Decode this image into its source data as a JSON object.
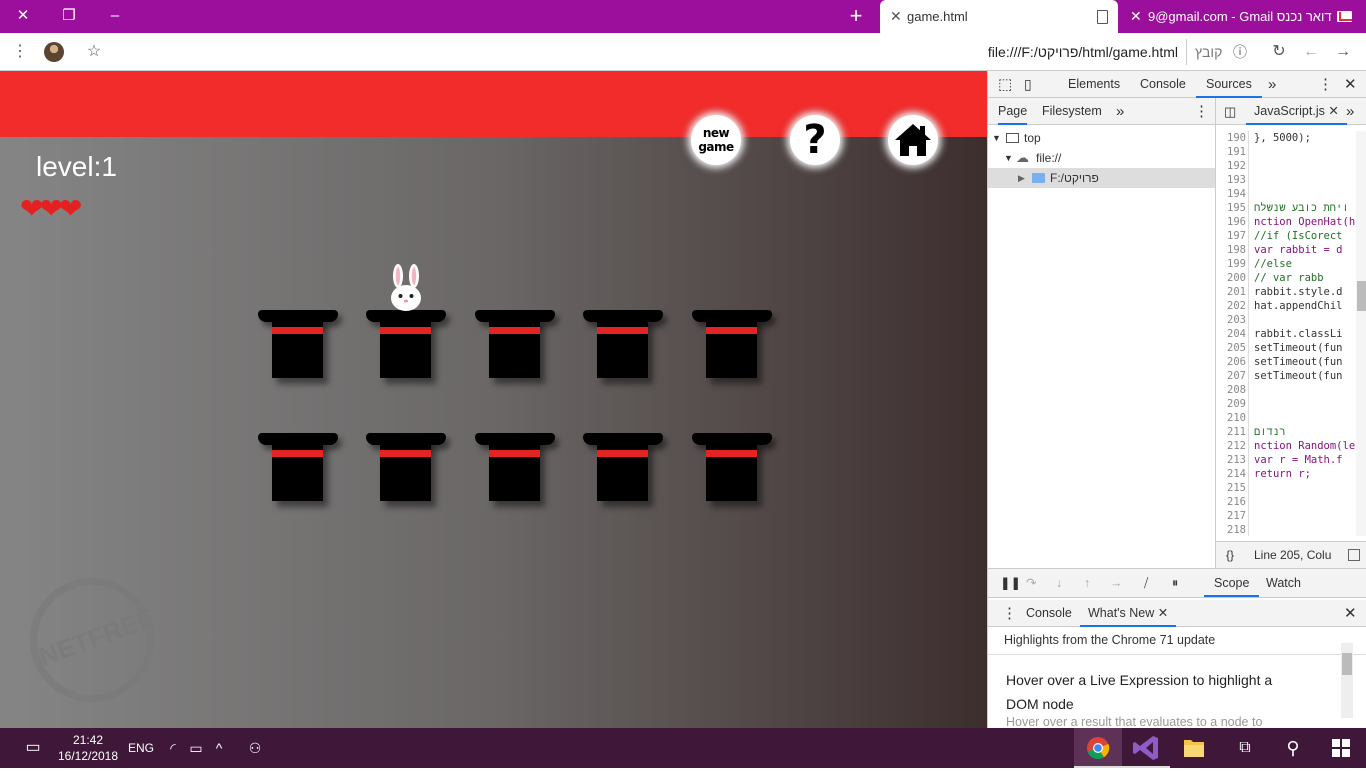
{
  "browser": {
    "tabs": [
      {
        "title": "game.html",
        "active": true
      },
      {
        "title": "9@gmail.com - Gmail דואר נכנס",
        "active": false
      }
    ],
    "new_tab_symbol": "+",
    "window_controls": {
      "close": "✕",
      "restore": "❐",
      "minimize": "–"
    },
    "url": "file:///F:/פרויקט/html/game.html",
    "url_scheme": "קובץ"
  },
  "game": {
    "level_text": "level:1",
    "hearts": "❤❤❤",
    "lives": 3,
    "new_game_label": "new game",
    "help_label": "?",
    "rows": 2,
    "hats_per_row": 5,
    "rabbit_hat": "row 1, hat 2",
    "watermark_text": "NETFREE"
  },
  "devtools": {
    "panel_tabs": [
      "Elements",
      "Console",
      "Sources"
    ],
    "active_panel": "Sources",
    "more_symbol": "»",
    "navigator_tabs": [
      "Page",
      "Filesystem"
    ],
    "tree": [
      {
        "label": "top"
      },
      {
        "label": "file://"
      },
      {
        "label": "F:/פרויקט"
      }
    ],
    "editor_tab": "JavaScript.js",
    "code": [
      {
        "n": "190",
        "t": "}, 5000);"
      },
      {
        "n": "191",
        "t": ""
      },
      {
        "n": "192",
        "t": ""
      },
      {
        "n": "193",
        "t": ""
      },
      {
        "n": "194",
        "t": ""
      },
      {
        "n": "195",
        "t": "ויחת כובע שנשלח"
      },
      {
        "n": "196",
        "t": "nction OpenHat(h"
      },
      {
        "n": "197",
        "t": " //if (IsCorect"
      },
      {
        "n": "198",
        "t": " var rabbit = d"
      },
      {
        "n": "199",
        "t": " //else"
      },
      {
        "n": "200",
        "t": " //    var rabb"
      },
      {
        "n": "201",
        "t": " rabbit.style.d"
      },
      {
        "n": "202",
        "t": " hat.appendChil"
      },
      {
        "n": "203",
        "t": ""
      },
      {
        "n": "204",
        "t": " rabbit.classLi"
      },
      {
        "n": "205",
        "t": " setTimeout(fun"
      },
      {
        "n": "206",
        "t": " setTimeout(fun"
      },
      {
        "n": "207",
        "t": " setTimeout(fun"
      },
      {
        "n": "208",
        "t": ""
      },
      {
        "n": "209",
        "t": ""
      },
      {
        "n": "210",
        "t": ""
      },
      {
        "n": "211",
        "t": "רנדום"
      },
      {
        "n": "212",
        "t": "nction Random(le"
      },
      {
        "n": "213",
        "t": " var r = Math.f"
      },
      {
        "n": "214",
        "t": " return r;"
      },
      {
        "n": "215",
        "t": ""
      },
      {
        "n": "216",
        "t": ""
      },
      {
        "n": "217",
        "t": ""
      },
      {
        "n": "218",
        "t": ""
      }
    ],
    "status": "Line 205, Colu",
    "format_symbol": "{}",
    "debug_tabs": [
      "Scope",
      "Watch"
    ],
    "drawer_tabs": [
      "Console",
      "What's New"
    ],
    "drawer_heading": "Highlights from the Chrome 71 update",
    "drawer_item_title": "Hover over a Live Expression to highlight a DOM node",
    "drawer_item_desc": "Hover over a result that evaluates to a node to"
  },
  "taskbar": {
    "time": "21:42",
    "date": "16/12/2018",
    "language": "ENG"
  },
  "colors": {
    "tab_strip": "#9c0f9c",
    "game_header": "#f22b2b",
    "hat_band": "#e32424",
    "heart": "#e52020",
    "taskbar": "#3f1839",
    "devtools_accent": "#1a73e8"
  },
  "icons": [
    "close-icon",
    "restore-icon",
    "minimize-icon",
    "new-tab-icon",
    "page-icon",
    "gmail-icon",
    "menu-icon",
    "star-icon",
    "info-icon",
    "reload-icon",
    "back-icon",
    "forward-icon",
    "home-icon",
    "rabbit-icon",
    "heart-icon"
  ]
}
